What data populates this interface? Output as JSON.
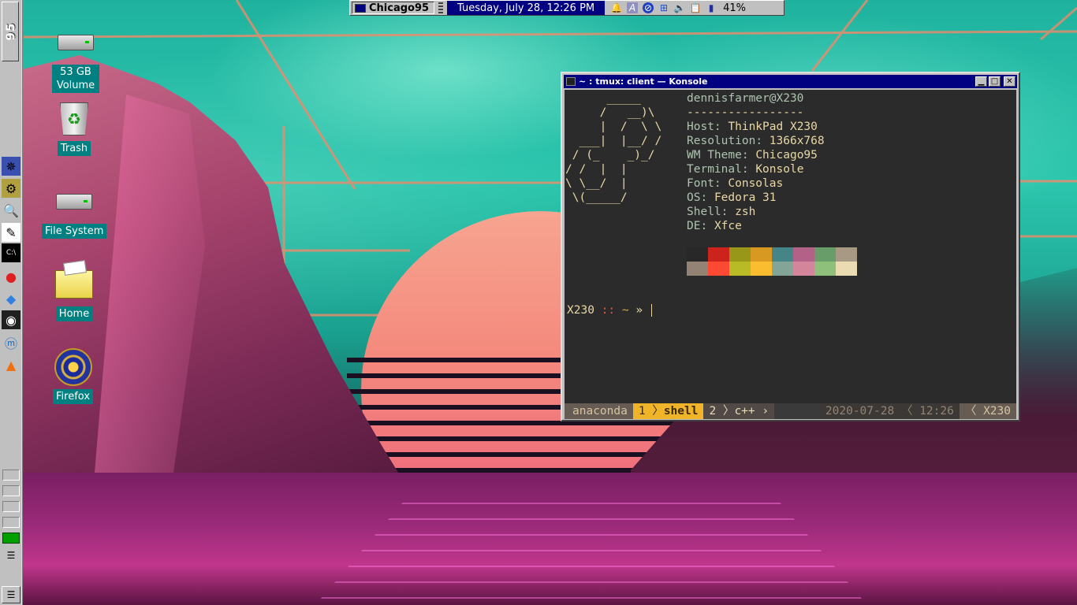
{
  "panel": {
    "start_label": "95",
    "task_button_label": "Chicago95",
    "clock": "Tuesday, July 28, 12:26 PM",
    "battery": "41%"
  },
  "desktop_icons": [
    {
      "label": "53 GB Volume",
      "icon": "drive-icon"
    },
    {
      "label": "Trash",
      "icon": "trash-icon"
    },
    {
      "label": "File System",
      "icon": "drive-icon"
    },
    {
      "label": "Home",
      "icon": "folder-icon"
    },
    {
      "label": "Firefox",
      "icon": "firefox-icon"
    }
  ],
  "konsole": {
    "title": "~ : tmux: client — Konsole",
    "neofetch": {
      "user": "dennisfarmer@X230",
      "separator": "-----------------",
      "lines": [
        {
          "key": "Host",
          "value": "ThinkPad X230"
        },
        {
          "key": "Resolution",
          "value": "1366x768"
        },
        {
          "key": "WM Theme",
          "value": "Chicago95"
        },
        {
          "key": "Terminal",
          "value": "Konsole"
        },
        {
          "key": "Font",
          "value": "Consolas"
        },
        {
          "key": "OS",
          "value": "Fedora 31"
        },
        {
          "key": "Shell",
          "value": "zsh"
        },
        {
          "key": "DE",
          "value": "Xfce"
        }
      ],
      "palette_top": [
        "#282828",
        "#cc241d",
        "#98971a",
        "#d79921",
        "#458588",
        "#b16286",
        "#689d6a",
        "#a89984"
      ],
      "palette_bottom": [
        "#928374",
        "#fb4934",
        "#b8bb26",
        "#fabd2f",
        "#83a598",
        "#d3869b",
        "#8ec07c",
        "#ebdbb2"
      ]
    },
    "prompt": {
      "host": "X230",
      "sep": "::",
      "dir": "~",
      "arrow": "»"
    },
    "status": {
      "session": "anaconda",
      "win1_index": "1",
      "win1_name": "shell",
      "win2_index": "2",
      "win2_name": "c++",
      "date": "2020-07-28",
      "time": "12:26",
      "host": "X230"
    }
  },
  "colors": {
    "title_bar": "#000080",
    "panel": "#c0c0c0",
    "desktop_label_bg": "#008080",
    "tmux_active": "#f0b42a"
  }
}
